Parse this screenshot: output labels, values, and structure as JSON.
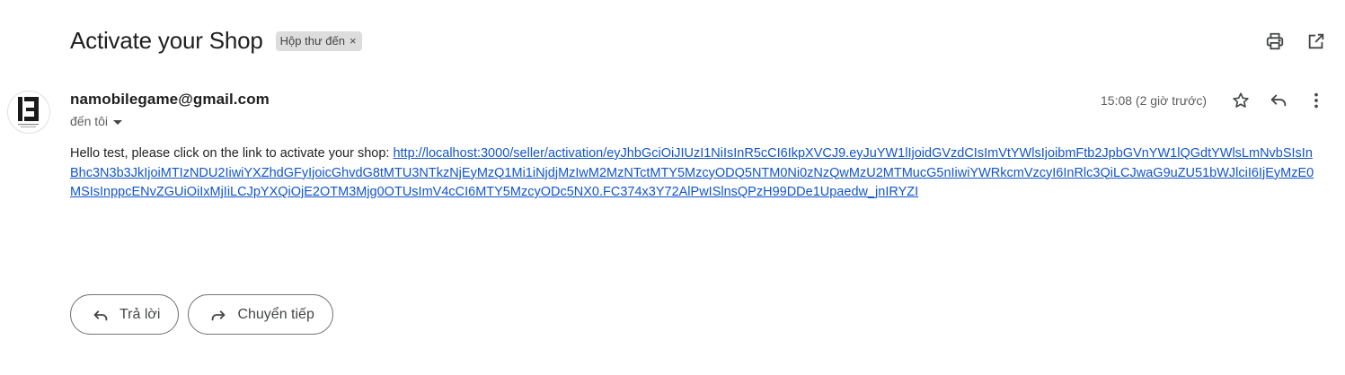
{
  "email": {
    "subject": "Activate your Shop",
    "label": "Hộp thư đến",
    "label_close": "×",
    "sender": "namobilegame@gmail.com",
    "recipient": "đến tôi",
    "time": "15:08 (2 giờ trước)",
    "body_prefix": "Hello test, please click on the link to activate your shop: ",
    "link": "http://localhost:3000/seller/activation/eyJhbGciOiJIUzI1NiIsInR5cCI6IkpXVCJ9.eyJuYW1lIjoidGVzdCIsImVtYWlsIjoibmFtb2JpbGVnYW1lQGdtYWlsLmNvbSIsInBhc3N3b3JkIjoiMTIzNDU2IiwiYXZhdGFyIjoicGhvdG8tMTU3NTkzNjEyMzQ1Mi1iNjdjMzIwM2MzNTctMTY5MzcyODQ5NTM0Ni0zNzQwMzU2MTMucG5nIiwiYWRkcmVzcyI6InRlc3QiLCJwaG9uZU51bWJlciI6IjEyMzE0MSIsInppcENvZGUiOiIxMjIiLCJpYXQiOjE2OTM3Mjg0OTUsImV4cCI6MTY5MzcyODc5NX0.FC374x3Y72AlPwISlnsQPzH99DDe1Upaedw_jnIRYZI"
  },
  "icons": {
    "print": "print-icon",
    "popout": "open-in-new-icon",
    "star": "star-icon",
    "reply": "reply-icon",
    "more": "more-vert-icon",
    "forward": "forward-icon"
  },
  "actions": {
    "reply_label": "Trả lời",
    "forward_label": "Chuyển tiếp"
  },
  "colors": {
    "link": "#1155cc",
    "chip_bg": "#dddddd",
    "pill_border": "#747775"
  }
}
